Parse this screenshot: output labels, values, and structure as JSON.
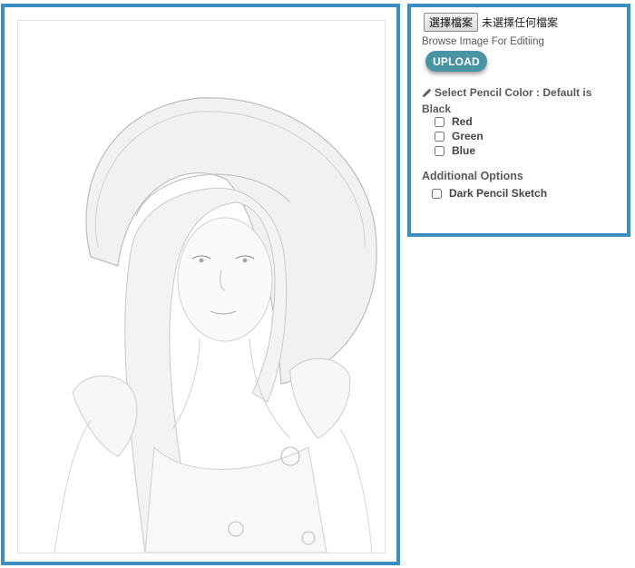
{
  "upload_form": {
    "file_button_label": "選擇檔案",
    "file_status": "未選擇任何檔案",
    "browse_label": "Browse Image For Editiing",
    "upload_button_label": "UPLOAD"
  },
  "pencil_color": {
    "icon": "pencil-icon",
    "header": "Select Pencil Color : Default is Black",
    "options": [
      {
        "label": "Red",
        "checked": false
      },
      {
        "label": "Green",
        "checked": false
      },
      {
        "label": "Blue",
        "checked": false
      }
    ]
  },
  "additional_options": {
    "header": "Additional Options",
    "options": [
      {
        "label": "Dark Pencil Sketch",
        "checked": false
      }
    ]
  },
  "colors": {
    "panel_border": "#3a8fc0",
    "upload_button": "#4a93a3"
  }
}
